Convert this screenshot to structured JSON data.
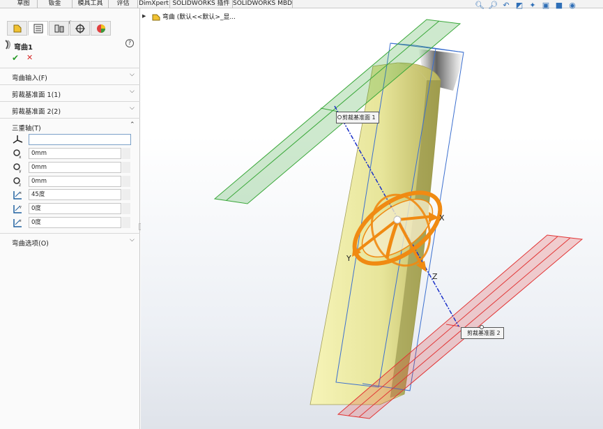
{
  "tabs": [
    "草图",
    "钣金",
    "模具工具",
    "评估",
    "DimXpert",
    "SOLIDWORKS 插件",
    "SOLIDWORKS MBD"
  ],
  "view_tools": [
    "zoom-fit-icon",
    "zoom-area-icon",
    "previous-view-icon",
    "section-view-icon",
    "dynamic-annotation-icon",
    "view-orientation-icon",
    "display-style-icon",
    "hide-show-icon"
  ],
  "property_manager": {
    "tab_icons": [
      "feature-manager-icon",
      "property-manager-icon",
      "configuration-manager-icon",
      "dimxpert-icon",
      "display-manager-icon"
    ],
    "title": "弯曲1",
    "help": "?",
    "ok": "✔",
    "cancel": "✕",
    "groups": {
      "bend_input": "弯曲输入(F)",
      "trim_plane_1": "剪裁基准面 1(1)",
      "trim_plane_2": "剪裁基准面 2(2)",
      "triad": "三重轴(T)",
      "bend_options": "弯曲选项(O)"
    },
    "triad": {
      "selection": "",
      "x": "0mm",
      "y": "0mm",
      "z": "0mm",
      "rot_x": "45度",
      "rot_y": "0度",
      "rot_z": "0度"
    }
  },
  "graphics": {
    "tree_label": "弯曲  (默认<<默认>_显...",
    "trim_plane_1_label": "剪裁基准面 1",
    "trim_plane_2_label": "剪裁基准面 2",
    "axis_x": "X",
    "axis_y": "Y",
    "axis_z": "Z",
    "colors": {
      "part": "#e7e59a",
      "trim_plane_1": "#3aa83a",
      "trim_plane_2": "#e23535",
      "triad": "#f08a12",
      "bounding_box": "#3b6fcf"
    }
  }
}
